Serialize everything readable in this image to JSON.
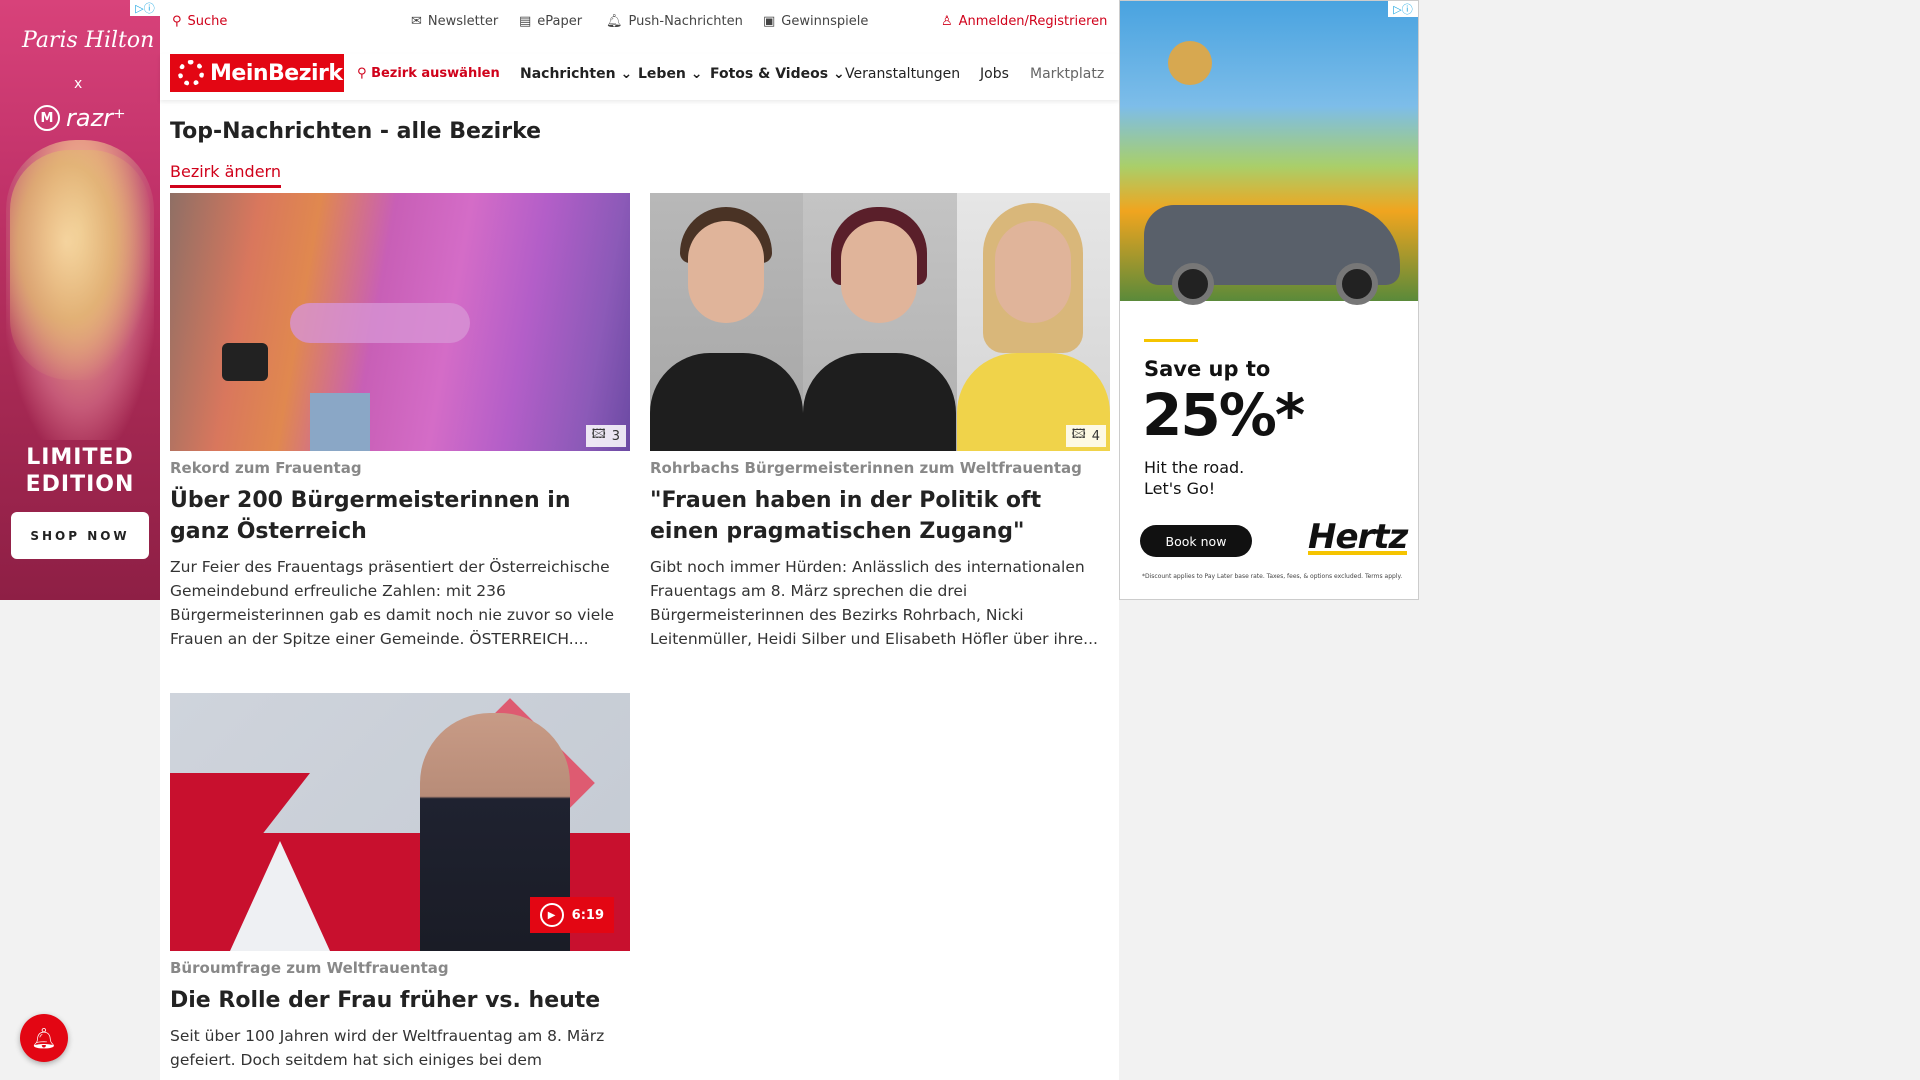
{
  "left_ad": {
    "script_name": "Paris Hilton",
    "cross": "x",
    "brand": "razr⁺",
    "brand_mark": "M",
    "headline": "LIMITED EDITION",
    "cta": "SHOP NOW",
    "adchoice_icon": "adchoices-icon"
  },
  "topbar": {
    "search": "Suche",
    "newsletter": "Newsletter",
    "epaper": "ePaper",
    "push": "Push-Nachrichten",
    "gewinnspiele": "Gewinnspiele",
    "login": "Anmelden/Registrieren"
  },
  "nav": {
    "logo": "MeinBezirk",
    "bezirk": "Bezirk auswählen",
    "items": [
      "Nachrichten",
      "Leben",
      "Fotos & Videos",
      "Veranstaltungen",
      "Jobs",
      "Marktplatz"
    ]
  },
  "page": {
    "title": "Top-Nachrichten - alle Bezirke",
    "change_link": "Bezirk ändern"
  },
  "articles": [
    {
      "kicker": "Rekord zum Frauentag",
      "title": "Über 200 Bürgermeisterinnen in ganz Österreich",
      "teaser": "Zur Feier des Frauentags präsentiert der Österreichische Gemeindebund erfreuliche Zahlen: mit 236 Bürgermeisterinnen gab es damit noch nie zuvor so viele Frauen an der Spitze einer Gemeinde. ÖSTERREICH....",
      "media_count": "3"
    },
    {
      "kicker": "Rohrbachs Bürgermeisterinnen zum Weltfrauentag",
      "title": "\"Frauen haben in der Politik oft einen pragmatischen Zugang\"",
      "teaser": "Gibt noch immer Hürden: Anlässlich des internationalen Frauentags am 8. März sprechen die drei Bürgermeisterinnen des Bezirks Rohrbach, Nicki Leitenmüller, Heidi Silber und Elisabeth Höfler über ihre...",
      "media_count": "4"
    },
    {
      "kicker": "Büroumfrage zum Weltfrauentag",
      "title": "Die Rolle der Frau früher vs. heute",
      "teaser": "Seit über 100 Jahren wird der Weltfrauentag am 8. März gefeiert. Doch seitdem hat sich einiges bei dem",
      "video_duration": "6:19"
    }
  ],
  "right_ad": {
    "save": "Save up to",
    "percent": "25%*",
    "hit_line1": "Hit the road.",
    "hit_line2": "Let's Go!",
    "cta": "Book now",
    "brand": "Hertz",
    "fine_print": "*Discount applies to Pay Later base rate. Taxes, fees, & options excluded. Terms apply.",
    "accent_color": "#f5c400"
  },
  "colors": {
    "brand_red": "#e30613",
    "link_red": "#d0021b"
  }
}
